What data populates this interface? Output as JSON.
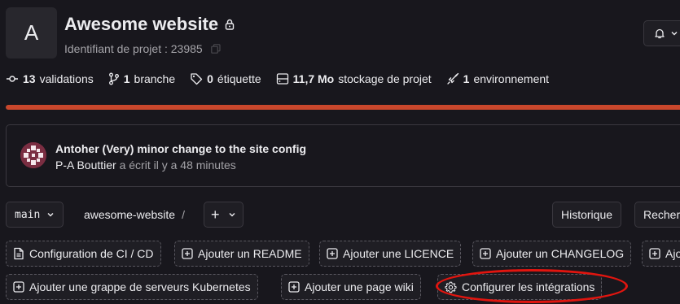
{
  "project": {
    "avatar_letter": "A",
    "name": "Awesome website",
    "id_text": "Identifiant de projet : 23985"
  },
  "stats": {
    "commits_value": "13",
    "commits_label": "validations",
    "branches_value": "1",
    "branches_label": "branche",
    "tags_value": "0",
    "tags_label": "étiquette",
    "storage_value": "11,7 Mo",
    "storage_label": "stockage de projet",
    "environments_value": "1",
    "environments_label": "environnement"
  },
  "language_bar": {
    "fill_percent": 100,
    "color": "#c9472c"
  },
  "last_commit": {
    "title": "Antoher (Very) minor change to the site config",
    "author": "P-A Bouttier",
    "time": "a écrit il y a 48 minutes"
  },
  "repo_nav": {
    "branch": "main",
    "path": "awesome-website",
    "path_separator": "/",
    "add_label": "+",
    "history_label": "Historique",
    "search_label": "Rechercher"
  },
  "quick_actions": {
    "ci_cd": "Configuration de CI / CD",
    "readme": "Ajouter un README",
    "licence": "Ajouter une LICENCE",
    "changelog": "Ajouter un CHANGELOG",
    "contributing": "Ajouter CONTRIBUTING",
    "kubernetes": "Ajouter une grappe de serveurs Kubernetes",
    "wiki": "Ajouter une page wiki",
    "integrations": "Configurer les intégrations"
  },
  "colors": {
    "background": "#18171d",
    "highlight": "#e1150f"
  }
}
